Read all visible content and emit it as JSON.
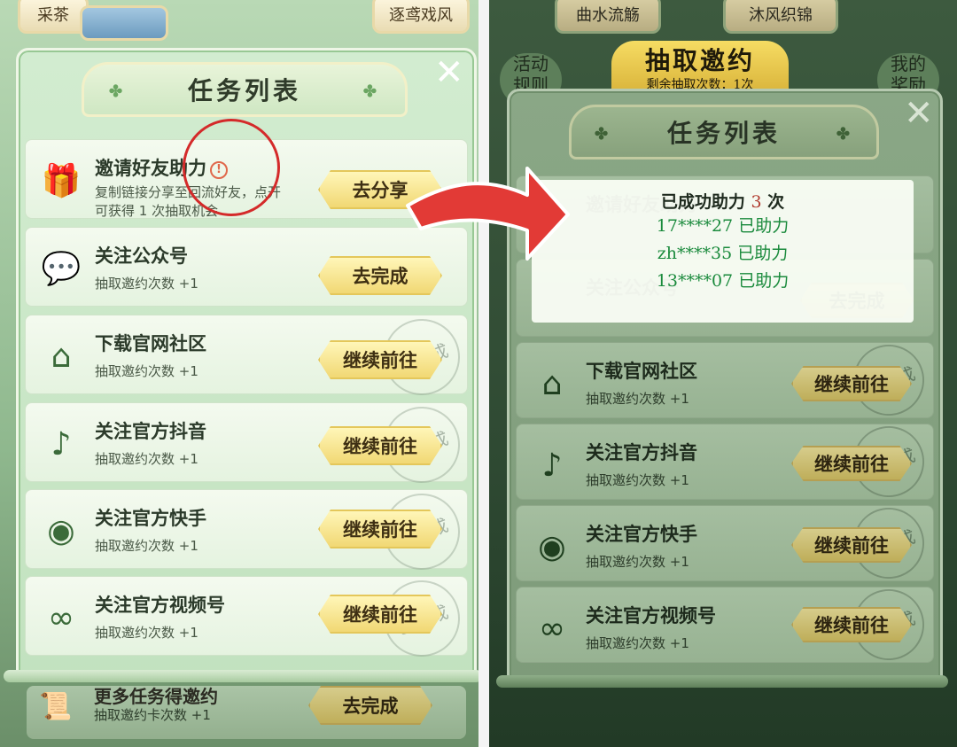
{
  "left_header_cards": [
    "采茶",
    "逐鸢戏风"
  ],
  "right_header_cards": [
    "曲水流觞",
    "沐风织锦"
  ],
  "right_side_labels": {
    "left": "活动\n规则",
    "right": "我的\n奖励"
  },
  "draw_banner": {
    "title": "抽取邀约",
    "subtitle": "剩余抽取次数：1次"
  },
  "panel_title": "任务列表",
  "close_symbol": "✕",
  "tasks": [
    {
      "icon": "gift-icon",
      "glyph": "🎁",
      "title": "邀请好友助力",
      "sub1": "复制链接分享至回流好友，点开",
      "sub2": "可获得 1 次抽取机会",
      "button": "去分享",
      "done": false
    },
    {
      "icon": "wechat-icon",
      "glyph": "💬",
      "title": "关注公众号",
      "sub1": "抽取邀约次数 +1",
      "button": "去完成",
      "done": false
    },
    {
      "icon": "home-icon",
      "glyph": "⌂",
      "title": "下载官网社区",
      "sub1": "抽取邀约次数 +1",
      "button": "继续前往",
      "done": true
    },
    {
      "icon": "tiktok-icon",
      "glyph": "♪",
      "title": "关注官方抖音",
      "sub1": "抽取邀约次数 +1",
      "button": "继续前往",
      "done": true
    },
    {
      "icon": "kuaishou-icon",
      "glyph": "◉",
      "title": "关注官方快手",
      "sub1": "抽取邀约次数 +1",
      "button": "继续前往",
      "done": true
    },
    {
      "icon": "video-channel-icon",
      "glyph": "∞",
      "title": "关注官方视频号",
      "sub1": "抽取邀约次数 +1",
      "button": "继续前往",
      "done": true
    }
  ],
  "done_stamp": "已完成",
  "bottom_task": {
    "title": "更多任务得邀约",
    "sub": "抽取邀约卡次数 +1",
    "button": "去完成"
  },
  "popup": {
    "title_prefix": "已成功助力",
    "count": "3",
    "title_suffix": "次",
    "helpers": [
      "17****27 已助力",
      "zh****35 已助力",
      "13****07 已助力"
    ]
  },
  "colors": {
    "accent": "#d42a2a",
    "helper_text": "#1a8a3c",
    "button": "#f1d874"
  }
}
